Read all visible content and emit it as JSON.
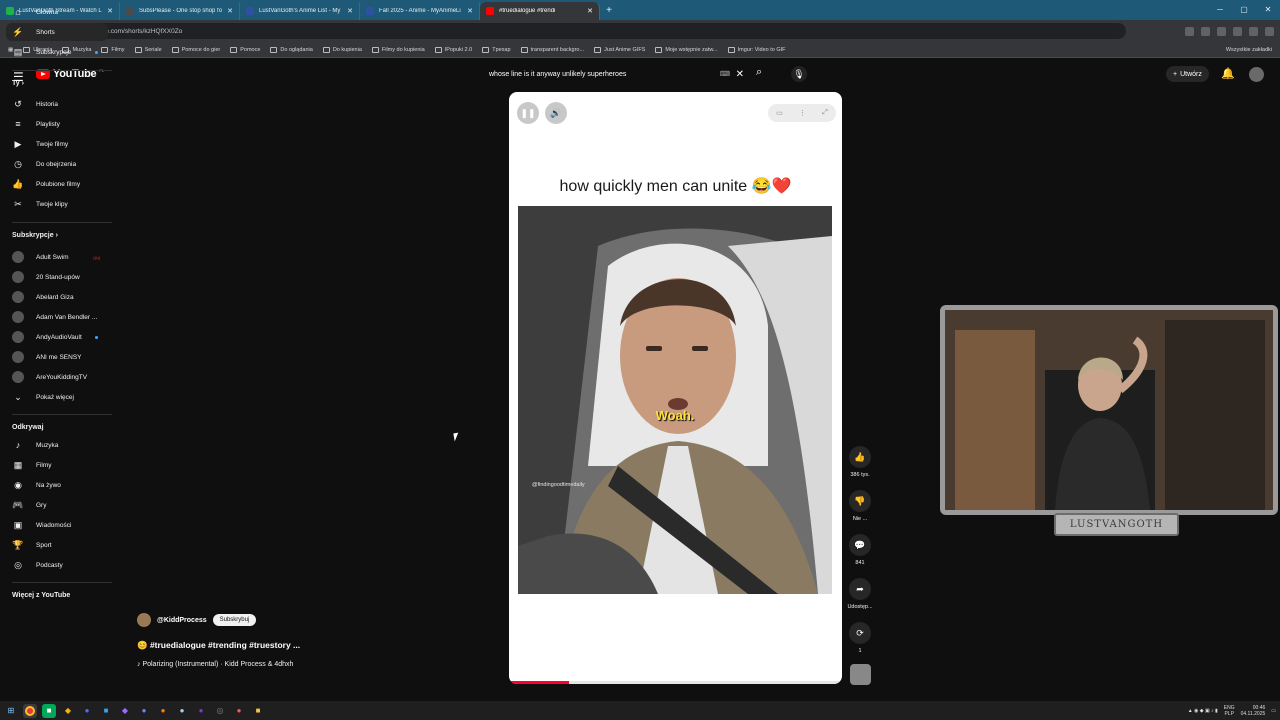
{
  "browser": {
    "tabs": [
      {
        "title": "LustVanGoth Stream - Watch Li",
        "color": "#1bb34a",
        "active": false
      },
      {
        "title": "SubsPlease - One stop shop fo",
        "color": "#4a4a4a",
        "active": false
      },
      {
        "title": "LustVanGoth's Anime List - My",
        "color": "#2e51a2",
        "active": false
      },
      {
        "title": "Fall 2025 - Anime - MyAnimeLi",
        "color": "#2e51a2",
        "active": false
      },
      {
        "title": "#truedialogue #trendi",
        "color": "#ff0000",
        "active": true
      }
    ],
    "url": "youtube.com/shorts/kzHQfXX0Zo",
    "bookmarks": [
      "Ubrania",
      "Muzyka",
      "Filmy",
      "Seriale",
      "Pomoce do gier",
      "Pomoce",
      "Do oglądania",
      "Do kupienia",
      "Filmy do kupienia",
      "IPopuki 2.0",
      "Tpexap",
      "transparent backgro...",
      "Just Anime GIFS",
      "Moje wstępnie zatw...",
      "Imgur: Video to GIF"
    ],
    "bookmarks_right": "Wszystkie zakładki"
  },
  "youtube": {
    "logo": "YouTube",
    "region": "PL",
    "search_query": "whose line is it anyway unlikely superheroes",
    "create_label": "Utwórz"
  },
  "sidebar": {
    "main": [
      {
        "label": "Główna",
        "icon": "home-icon"
      },
      {
        "label": "Shorts",
        "icon": "shorts-icon"
      },
      {
        "label": "Subskrypcje",
        "icon": "subscriptions-icon"
      }
    ],
    "you_header": "Ty",
    "you": [
      {
        "label": "Historia",
        "icon": "history-icon"
      },
      {
        "label": "Playlisty",
        "icon": "playlist-icon"
      },
      {
        "label": "Twoje filmy",
        "icon": "your-videos-icon"
      },
      {
        "label": "Do obejrzenia",
        "icon": "watch-later-icon"
      },
      {
        "label": "Polubione filmy",
        "icon": "liked-icon"
      },
      {
        "label": "Twoje klipy",
        "icon": "clips-icon"
      }
    ],
    "subs_header": "Subskrypcje",
    "subs": [
      {
        "label": "Adult Swim"
      },
      {
        "label": "20 Stand-upów"
      },
      {
        "label": "Abelard Giza"
      },
      {
        "label": "Adam Van Bendler ..."
      },
      {
        "label": "AndyAudioVault"
      },
      {
        "label": "ANI me SENSY"
      },
      {
        "label": "AreYouKiddingTV"
      }
    ],
    "show_more": "Pokaż więcej",
    "explore_header": "Odkrywaj",
    "explore": [
      {
        "label": "Muzyka",
        "icon": "music-icon"
      },
      {
        "label": "Filmy",
        "icon": "movies-icon"
      },
      {
        "label": "Na żywo",
        "icon": "live-icon"
      },
      {
        "label": "Gry",
        "icon": "gaming-icon"
      },
      {
        "label": "Wiadomości",
        "icon": "news-icon"
      },
      {
        "label": "Sport",
        "icon": "sport-icon"
      },
      {
        "label": "Podcasty",
        "icon": "podcast-icon"
      }
    ],
    "more_header": "Więcej z YouTube"
  },
  "short": {
    "caption": "how quickly men can unite 😂❤️",
    "subtitle": "Woah.",
    "watermark": "@findingoodtimedaily",
    "progress": 0.18,
    "channel": "@KiddProcess",
    "subscribe": "Subskrybuj",
    "title": "😊 #truedialogue #trending #truestory ...",
    "music": "♪ Polarizing (Instrumental) · Kidd Process & 4dhxh"
  },
  "actions": {
    "likes": "386 tys.",
    "dislike": "Nie ...",
    "comments": "841",
    "share": "Udostęp...",
    "remix": "1"
  },
  "webcam": {
    "label": "LUSTVANGOTH"
  },
  "taskbar": {
    "lang": "ENG\nPLP",
    "time": "00:46",
    "date": "04.11.2025"
  }
}
